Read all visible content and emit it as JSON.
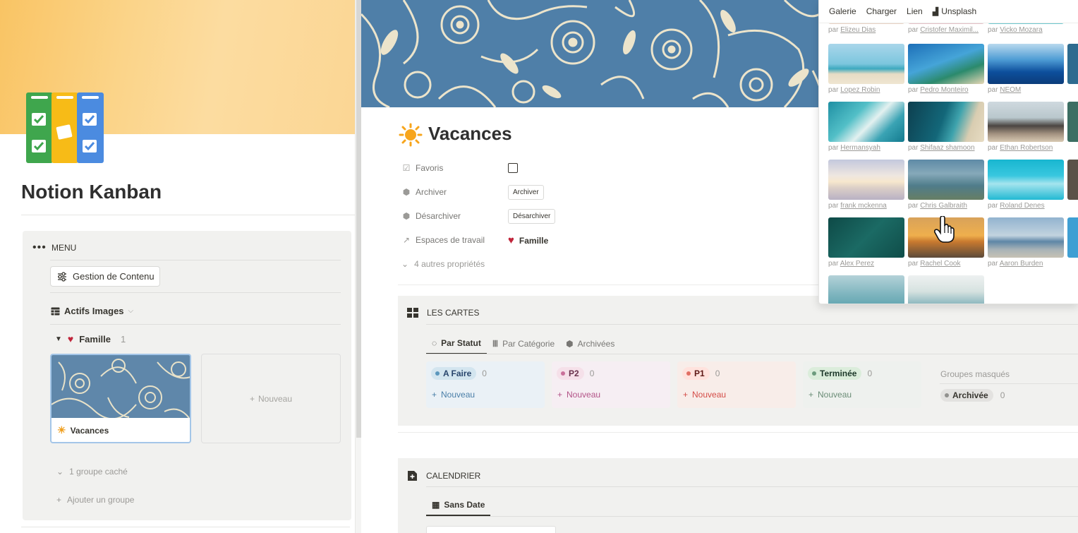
{
  "left": {
    "title": "Notion Kanban",
    "menu": {
      "label": "MENU",
      "gestion_button": "Gestion de Contenu",
      "database_title": "Actifs Images",
      "group": {
        "name": "Famille",
        "count": "1"
      },
      "cards": [
        {
          "title": "Vacances"
        }
      ],
      "new_card": "Nouveau",
      "hidden_groups": "1 groupe caché",
      "add_group": "Ajouter un groupe"
    }
  },
  "page": {
    "title": "Vacances",
    "properties": [
      {
        "icon": "checkbox-icon",
        "name": "Favoris"
      },
      {
        "icon": "box-icon",
        "name": "Archiver",
        "button": "Archiver"
      },
      {
        "icon": "box-icon",
        "name": "Désarchiver",
        "button": "Désarchiver"
      },
      {
        "icon": "arrow-up-right-icon",
        "name": "Espaces de travail",
        "value": "Famille"
      }
    ],
    "more_props": "4 autres propriétés"
  },
  "cartes": {
    "title": "LES CARTES",
    "tabs": [
      "Par Statut",
      "Par Catégorie",
      "Archivées"
    ],
    "columns": [
      {
        "name": "A Faire",
        "count": "0",
        "new": "Nouveau"
      },
      {
        "name": "P2",
        "count": "0",
        "new": "Nouveau"
      },
      {
        "name": "P1",
        "count": "0",
        "new": "Nouveau"
      },
      {
        "name": "Terminée",
        "count": "0",
        "new": "Nouveau"
      }
    ],
    "hidden_groups": "Groupes masqués",
    "archived": {
      "name": "Archivée",
      "count": "0"
    }
  },
  "calendrier": {
    "title": "CALENDRIER",
    "tab": "Sans Date"
  },
  "popup": {
    "tabs": [
      "Galerie",
      "Charger",
      "Lien",
      "Unsplash"
    ],
    "prefix": "par",
    "photos": [
      {
        "author": "Elizeu Dias"
      },
      {
        "author": "Cristofer Maximil..."
      },
      {
        "author": "Vicko Mozara"
      },
      {
        "author": "Lopez Robin"
      },
      {
        "author": "Pedro Monteiro"
      },
      {
        "author": "NEOM"
      },
      {
        "author": "Hermansyah"
      },
      {
        "author": "Shifaaz shamoon"
      },
      {
        "author": "Ethan Robertson"
      },
      {
        "author": "frank mckenna"
      },
      {
        "author": "Chris Galbraith"
      },
      {
        "author": "Roland Denes"
      },
      {
        "author": "Alex Perez"
      },
      {
        "author": "Rachel Cook"
      },
      {
        "author": "Aaron Burden"
      }
    ]
  }
}
